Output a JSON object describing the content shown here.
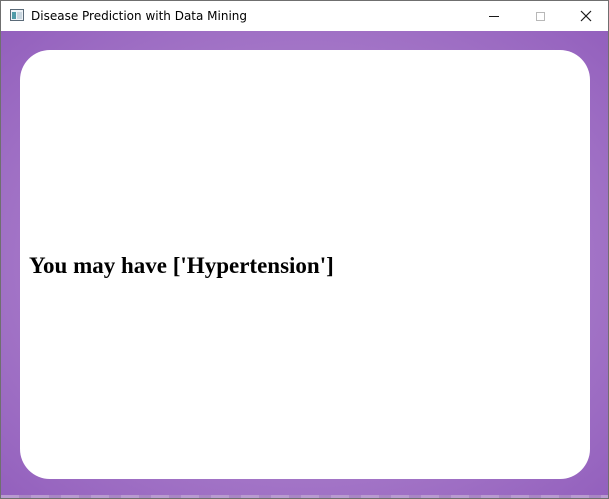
{
  "window": {
    "title": "Disease Prediction with Data Mining",
    "icon": "app-window-icon",
    "controls": [
      "minimize-icon",
      "maximize-icon",
      "close-icon"
    ]
  },
  "content": {
    "background_colors": [
      "#c8a6de",
      "#a77ac9",
      "#9360bd"
    ],
    "card_color": "#ffffff",
    "result_text": "You may have ['Hypertension']"
  }
}
